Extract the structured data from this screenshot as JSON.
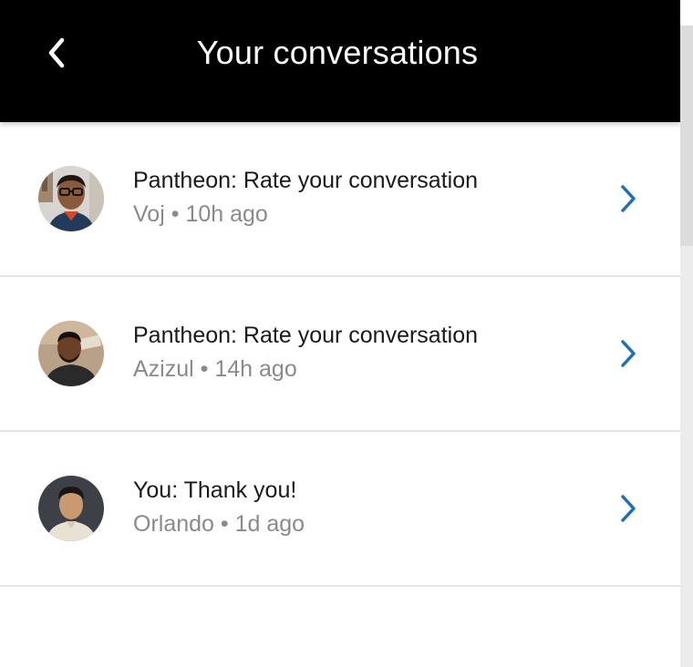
{
  "header": {
    "title": "Your conversations",
    "back_icon": "chevron-left-icon"
  },
  "conversations": [
    {
      "title": "Pantheon: Rate your conversation",
      "name": "Voj",
      "time": "10h ago",
      "avatar_icon": "avatar-voj"
    },
    {
      "title": "Pantheon: Rate your conversation",
      "name": "Azizul",
      "time": "14h ago",
      "avatar_icon": "avatar-azizul"
    },
    {
      "title": "You: Thank you!",
      "name": "Orlando",
      "time": "1d ago",
      "avatar_icon": "avatar-orlando"
    }
  ],
  "separator": "•",
  "colors": {
    "header_bg": "#000000",
    "header_text": "#ffffff",
    "chevron": "#1f6fb5",
    "meta_text": "#8a8a8a",
    "divider": "#e4e4e4"
  }
}
